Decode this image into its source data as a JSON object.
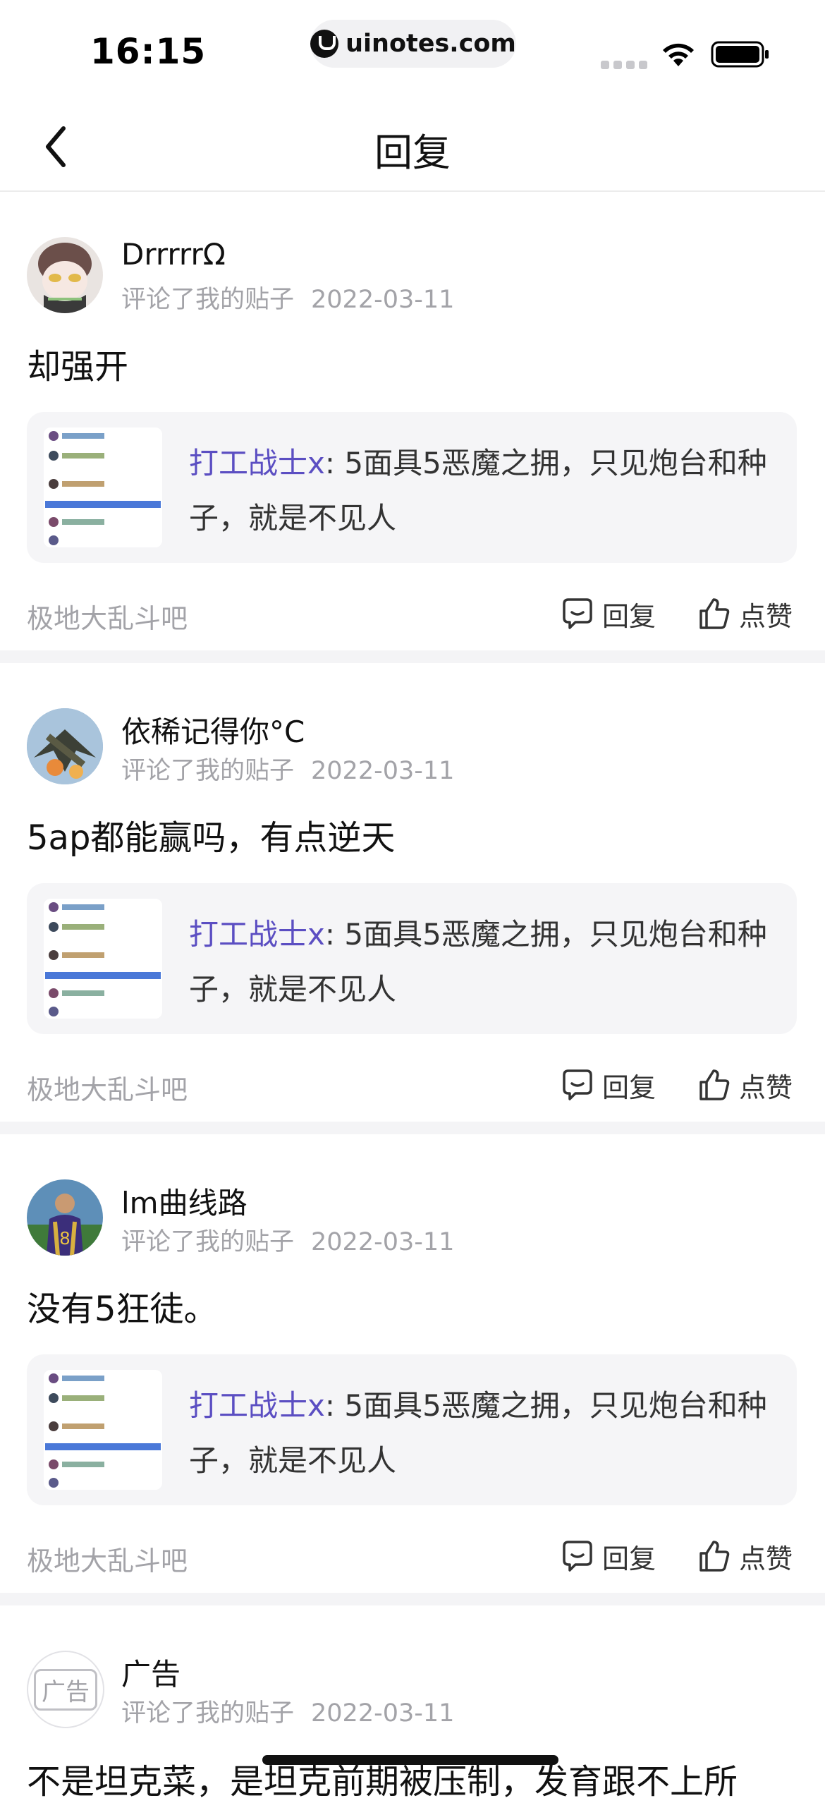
{
  "status_bar": {
    "time": "16:15",
    "url": "uinotes.com"
  },
  "nav": {
    "title": "回复"
  },
  "posts": [
    {
      "username": "DrrrrrΩ",
      "action_text": "评论了我的贴子",
      "date": "2022-03-11",
      "comment": "却强开",
      "quote_author": "打工战士x",
      "quote_text": ": 5面具5恶魔之拥，只见炮台和种子，就是不见人",
      "forum": "极地大乱斗吧",
      "reply_label": "回复",
      "like_label": "点赞"
    },
    {
      "username": "依稀记得你°C",
      "action_text": "评论了我的贴子",
      "date": "2022-03-11",
      "comment": "5ap都能赢吗，有点逆天",
      "quote_author": "打工战士x",
      "quote_text": ": 5面具5恶魔之拥，只见炮台和种子，就是不见人",
      "forum": "极地大乱斗吧",
      "reply_label": "回复",
      "like_label": "点赞"
    },
    {
      "username": "lm曲线路",
      "action_text": "评论了我的贴子",
      "date": "2022-03-11",
      "comment": "没有5狂徒。",
      "quote_author": "打工战士x",
      "quote_text": ": 5面具5恶魔之拥，只见炮台和种子，就是不见人",
      "forum": "极地大乱斗吧",
      "reply_label": "回复",
      "like_label": "点赞"
    }
  ],
  "ad_post": {
    "badge": "广告",
    "username": "广告",
    "action_text": "评论了我的贴子",
    "date": "2022-03-11",
    "comment": "不是坦克菜，是坦克前期被压制，发育跟不上所"
  },
  "colors": {
    "accent": "#5b4ec2",
    "muted": "#a3a3a8",
    "quote_bg": "#f5f5f7"
  }
}
